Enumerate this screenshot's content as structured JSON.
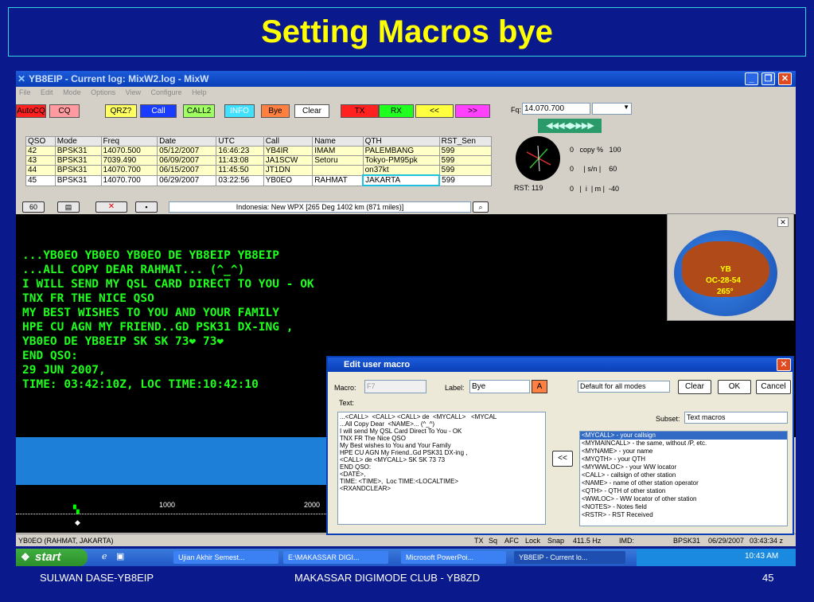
{
  "slide": {
    "title": "Setting Macros bye",
    "footer_left": "SULWAN DASE-YB8EIP",
    "footer_center": "MAKASSAR DIGIMODE CLUB - YB8ZD",
    "page_number": "45"
  },
  "app": {
    "title": "YB8EIP - Current log: MixW2.log - MixW",
    "menu": [
      "File",
      "Edit",
      "Mode",
      "Options",
      "View",
      "Configure",
      "Help"
    ],
    "toolbar": [
      {
        "label": "AutoCQ",
        "color": "#ff2020"
      },
      {
        "label": "CQ",
        "color": "#ff9aa0"
      },
      {
        "label": "QRZ?",
        "color": "#ffff60"
      },
      {
        "label": "Call",
        "color": "#1a3cff"
      },
      {
        "label": "CALL2",
        "color": "#a0ff60"
      },
      {
        "label": "INFO",
        "color": "#40e0ff"
      },
      {
        "label": "Bye",
        "color": "#ff8040"
      },
      {
        "label": "Clear",
        "color": "#ffffff"
      },
      {
        "label": "TX",
        "color": "#ff2020"
      },
      {
        "label": "RX",
        "color": "#20ff20"
      },
      {
        "label": "<<",
        "color": "#ffff40"
      },
      {
        "label": ">>",
        "color": "#ff40ff"
      }
    ],
    "frequency": {
      "label": "Fq:",
      "value": "14.070.700"
    },
    "tuning_arrows": "◀◀◀◀▶▶▶▶",
    "log": {
      "headers": [
        "QSO",
        "Mode",
        "Freq",
        "Date",
        "UTC",
        "Call",
        "Name",
        "QTH",
        "RST_Sen"
      ],
      "rows": [
        [
          "42",
          "BPSK31",
          "14070.500",
          "05/12/2007",
          "16:46:23",
          "YB4IR",
          "IMAM",
          "PALEMBANG",
          "599"
        ],
        [
          "43",
          "BPSK31",
          "7039.490",
          "06/09/2007",
          "11:43:08",
          "JA1SCW",
          "Setoru",
          "Tokyo-PM95pk",
          "599"
        ],
        [
          "44",
          "BPSK31",
          "14070.700",
          "06/15/2007",
          "11:45:50",
          "JT1DN",
          "",
          "on37kt",
          "599"
        ],
        [
          "45",
          "BPSK31",
          "14070.700",
          "06/29/2007",
          "03:22:56",
          "YB0EO",
          "RAHMAT",
          "JAKARTA",
          "599"
        ]
      ]
    },
    "meters": {
      "copy": "0   copy %   100",
      "sn": "0     | s/n |    60",
      "imd": "0   |  i  | m |  -40",
      "rst": "RST: 119"
    },
    "info_line": "Indonesia:  New WPX [265 Deg  1402 km (871 miles)]",
    "terminal_lines": [
      "...YB0EO  YB0EO YB0EO DE  YB8EIP   YB8EIP",
      "...ALL COPY DEAR  RAHMAT... (^_^)",
      "I WILL SEND MY QSL CARD DIRECT TO YOU - OK",
      "TNX FR THE NICE QSO",
      "MY BEST WISHES TO YOU AND YOUR FAMILY",
      "HPE CU AGN MY FRIEND..GD PSK31 DX-ING ,",
      "YB0EO DE YB8EIP SK SK 73❤ 73❤",
      "END QSO:",
      "29 JUN 2007,",
      "TIME: 03:42:10Z,  LOC TIME:10:42:10"
    ],
    "scale": {
      "mark1": "1000",
      "mark2": "2000"
    },
    "globe": {
      "call": "YB",
      "loc": "OC-28-54",
      "bearing": "265°"
    },
    "status": {
      "left": "YB0EO (RAHMAT, JAKARTA)",
      "tx": "TX",
      "sq": "Sq",
      "afc": "AFC",
      "lock": "Lock",
      "snap": "Snap",
      "freq": "411.5 Hz",
      "imd": "IMD:",
      "mode": "BPSK31",
      "date": "06/29/2007",
      "time": "03:43:34 z"
    }
  },
  "dialog": {
    "title": "Edit user macro",
    "macro_label": "Macro:",
    "macro_value": "F7",
    "label_label": "Label:",
    "label_value": "Bye",
    "key": "A",
    "scope": "Default for all modes",
    "clear": "Clear",
    "ok": "OK",
    "cancel": "Cancel",
    "text_label": "Text:",
    "text": "...<CALL>  <CALL> <CALL> de  <MYCALL>   <MYCAL\n...All Copy Dear  <NAME>... (^_^)\nI will send My QSL Card Direct To You - OK\nTNX FR The Nice QSO\nMy Best wishes to You and Your Family\nHPE CU AGN My Friend..Gd PSK31 DX-ing ,\n<CALL> de <MYCALL> SK SK 73 73\nEND QSO:\n<DATE>,\nTIME: <TIME>,  Loc TIME:<LOCALTIME>\n<RXANDCLEAR>",
    "insert": "<<",
    "subset_label": "Subset:",
    "subset_value": "Text macros",
    "list": [
      "<MYCALL> - your callsign",
      "<MYMAINCALL> - the same, without /P, etc.",
      "<MYNAME> - your name",
      "<MYQTH> - your QTH",
      "<MYWWLOC> - your WW locator",
      "<CALL> - callsign of other station",
      "<NAME> - name of other station operator",
      "<QTH> - QTH of other station",
      "<WWLOC> - WW locator of other station",
      "<NOTES> - Notes field",
      "<RSTR> - RST Received"
    ]
  },
  "taskbar": {
    "start": "start",
    "tasks": [
      "Ujian Akhir Semest...",
      "E:\\MAKASSAR DIGI...",
      "Microsoft PowerPoi...",
      "YB8EIP - Current lo..."
    ],
    "clock": "10:43 AM"
  }
}
